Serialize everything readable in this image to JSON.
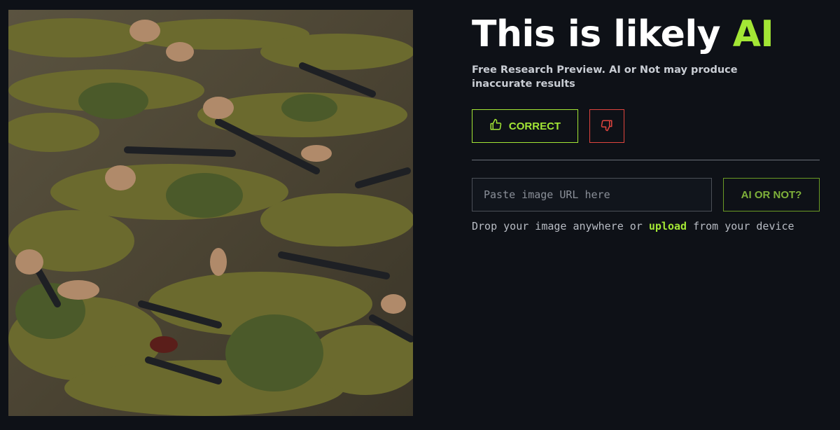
{
  "result": {
    "heading_prefix": "This is likely ",
    "heading_verdict": "AI",
    "disclaimer": "Free Research Preview. AI or Not may produce inaccurate results"
  },
  "feedback": {
    "correct_label": "CORRECT",
    "correct_icon": "thumbs-up-icon",
    "incorrect_icon": "thumbs-down-icon"
  },
  "checker": {
    "url_placeholder": "Paste image URL here",
    "url_value": "",
    "submit_label": "AI OR NOT?",
    "drop_prefix": "Drop your image anywhere or ",
    "drop_link": "upload",
    "drop_suffix": " from your device"
  },
  "colors": {
    "background": "#0e1117",
    "accent": "#a3e635",
    "danger": "#e0443e",
    "text": "#ffffff"
  }
}
